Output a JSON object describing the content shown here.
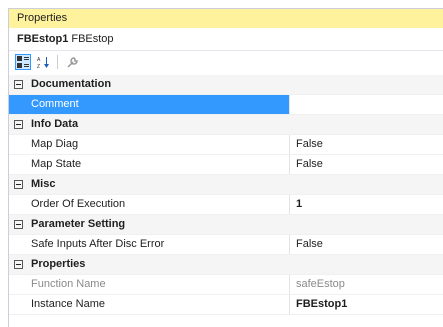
{
  "window": {
    "title": "Properties"
  },
  "object": {
    "name": "FBEstop1",
    "type": "FBEstop"
  },
  "toolbar": {
    "buttons": [
      {
        "icon": "categorized-icon",
        "active": true
      },
      {
        "icon": "alphabetical-icon",
        "active": false
      },
      {
        "icon": "wrench-icon",
        "active": false
      }
    ]
  },
  "grid": {
    "categories": {
      "documentation": "Documentation",
      "info_data": "Info Data",
      "misc": "Misc",
      "parameter_setting": "Parameter Setting",
      "properties": "Properties"
    },
    "rows": {
      "comment": {
        "name": "Comment",
        "value": ""
      },
      "map_diag": {
        "name": "Map Diag",
        "value": "False"
      },
      "map_state": {
        "name": "Map State",
        "value": "False"
      },
      "order": {
        "name": "Order Of Execution",
        "value": "1"
      },
      "safe_inputs": {
        "name": "Safe Inputs After Disc Error",
        "value": "False"
      },
      "function_name": {
        "name": "Function Name",
        "value": "safeEstop"
      },
      "instance_name": {
        "name": "Instance Name",
        "value": "FBEstop1"
      }
    }
  },
  "colors": {
    "title_bar": "#fff29d",
    "selection": "#3399ff",
    "category_bg": "#f5f5f5"
  }
}
